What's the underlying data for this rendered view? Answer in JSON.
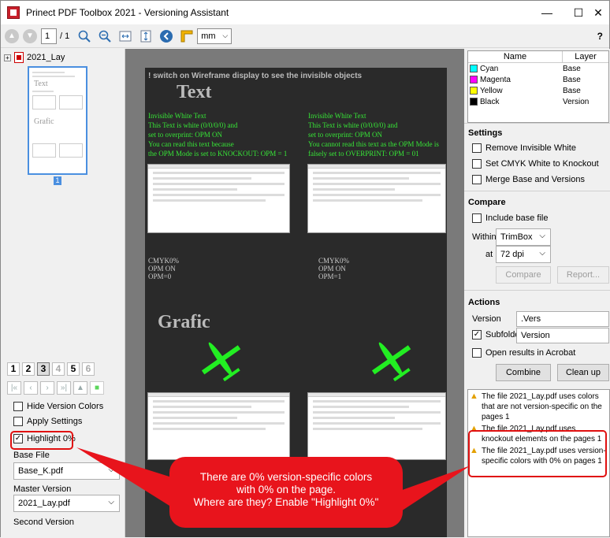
{
  "window": {
    "title": "Prinect PDF Toolbox 2021 - Versioning Assistant",
    "minimize": "—",
    "maximize": "☐",
    "close": "✕"
  },
  "toolbar": {
    "page_value": "1",
    "page_total": "/ 1",
    "unit_value": "mm",
    "help": "?"
  },
  "left": {
    "tree_label": "2021_Lay",
    "thumb_title_1": "Text",
    "thumb_title_2": "Grafic",
    "page_badge": "1",
    "version_numbers": [
      "1",
      "2",
      "3",
      "4",
      "5",
      "6"
    ],
    "hide_version_colors": "Hide Version Colors",
    "apply_settings": "Apply Settings",
    "highlight": "Highlight 0%",
    "base_file_label": "Base File",
    "base_file_value": "Base_K.pdf",
    "master_label": "Master Version",
    "master_value": "2021_Lay.pdf",
    "second_label": "Second Version"
  },
  "page": {
    "note": "! switch on Wireframe display to see the invisible objects",
    "title_text": "Text",
    "title_grafic": "Grafic",
    "left_green": [
      "Invisible White Text",
      "This Text is white (0/0/0/0) and",
      "set to overprint: OPM ON",
      "You can read this text because",
      "the OPM Mode is set to KNOCKOUT: OPM = 1"
    ],
    "right_green": [
      "Invisible White Text",
      "This Text is white (0/0/0/0) and",
      "set to overprint: OPM ON",
      "You cannot read this text as the OPM Mode is",
      "falsely set to OVERPRINT: OPM = 01"
    ],
    "left_cmyk": [
      "CMYK0%",
      "OPM ON",
      "OPM=0"
    ],
    "right_cmyk": [
      "CMYK0%",
      "OPM ON",
      "OPM=1"
    ]
  },
  "callout": {
    "line1": "There are 0% version-specific colors",
    "line2": "with 0% on the page.",
    "line3": "Where are they? Enable \"Highlight 0%\""
  },
  "layers": {
    "col_name": "Name",
    "col_layer": "Layer",
    "rows": [
      {
        "name": "Cyan",
        "layer": "Base",
        "color": "#00ffff"
      },
      {
        "name": "Magenta",
        "layer": "Base",
        "color": "#ff00ff"
      },
      {
        "name": "Yellow",
        "layer": "Base",
        "color": "#ffff00"
      },
      {
        "name": "Black",
        "layer": "Version",
        "color": "#000000"
      }
    ]
  },
  "settings": {
    "heading": "Settings",
    "remove_white": "Remove Invisible White",
    "cmyk_knockout": "Set CMYK White to Knockout",
    "merge": "Merge Base and Versions"
  },
  "compare": {
    "heading": "Compare",
    "include_base": "Include base file",
    "within_label": "Within",
    "within_value": "TrimBox",
    "at_label": "at",
    "at_value": "72 dpi",
    "compare_btn": "Compare",
    "report_btn": "Report..."
  },
  "actions": {
    "heading": "Actions",
    "version_label": "Version",
    "version_value": ".Vers",
    "subfolder_label": "Subfolder",
    "subfolder_value": "Version",
    "open_acrobat": "Open results in Acrobat",
    "combine_btn": "Combine",
    "cleanup_btn": "Clean up"
  },
  "messages": [
    "The file 2021_Lay.pdf uses colors that are not version-specific on the pages 1",
    "The file 2021_Lay.pdf uses knockout elements on the pages 1",
    "The file 2021_Lay.pdf uses version-specific colors with 0% on pages 1"
  ]
}
